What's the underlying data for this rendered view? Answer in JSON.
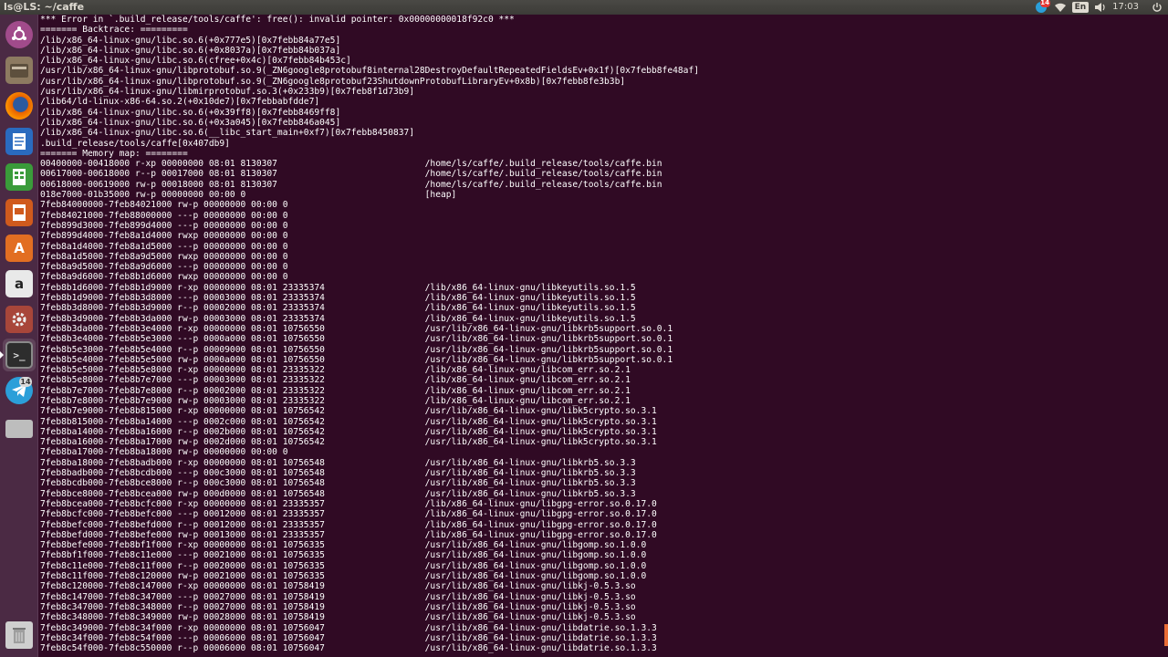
{
  "panel": {
    "window_title": "ls@LS: ~/caffe",
    "telegram_badge": "14",
    "language": "En",
    "time": "17:03"
  },
  "launcher": {
    "items": [
      {
        "name": "dash-icon",
        "glyph": ""
      },
      {
        "name": "files-icon",
        "glyph": ""
      },
      {
        "name": "firefox-icon",
        "glyph": ""
      },
      {
        "name": "writer-icon",
        "glyph": ""
      },
      {
        "name": "calc-icon",
        "glyph": ""
      },
      {
        "name": "impress-icon",
        "glyph": ""
      },
      {
        "name": "software-center-icon",
        "glyph": "A"
      },
      {
        "name": "amazon-icon",
        "glyph": "a"
      },
      {
        "name": "settings-icon",
        "glyph": ""
      },
      {
        "name": "terminal-icon",
        "glyph": ">_"
      },
      {
        "name": "telegram-icon",
        "glyph": "",
        "badge": "14"
      },
      {
        "name": "drive-icon",
        "glyph": ""
      },
      {
        "name": "trash-icon",
        "glyph": ""
      }
    ]
  },
  "terminal": {
    "lines": [
      "*** Error in `.build_release/tools/caffe': free(): invalid pointer: 0x00000000018f92c0 ***",
      "======= Backtrace: =========",
      "/lib/x86_64-linux-gnu/libc.so.6(+0x777e5)[0x7febb84a77e5]",
      "/lib/x86_64-linux-gnu/libc.so.6(+0x8037a)[0x7febb84b037a]",
      "/lib/x86_64-linux-gnu/libc.so.6(cfree+0x4c)[0x7febb84b453c]",
      "/usr/lib/x86_64-linux-gnu/libprotobuf.so.9(_ZN6google8protobuf8internal28DestroyDefaultRepeatedFieldsEv+0x1f)[0x7febb8fe48af]",
      "/usr/lib/x86_64-linux-gnu/libprotobuf.so.9(_ZN6google8protobuf23ShutdownProtobufLibraryEv+0x8b)[0x7febb8fe3b3b]",
      "/usr/lib/x86_64-linux-gnu/libmirprotobuf.so.3(+0x233b9)[0x7feb8f1d73b9]",
      "/lib64/ld-linux-x86-64.so.2(+0x10de7)[0x7febbabfdde7]",
      "/lib/x86_64-linux-gnu/libc.so.6(+0x39ff8)[0x7febb8469ff8]",
      "/lib/x86_64-linux-gnu/libc.so.6(+0x3a045)[0x7febb846a045]",
      "/lib/x86_64-linux-gnu/libc.so.6(__libc_start_main+0xf7)[0x7febb8450837]",
      ".build_release/tools/caffe[0x407db9]",
      "======= Memory map: ========",
      "00400000-00418000 r-xp 00000000 08:01 8130307                            /home/ls/caffe/.build_release/tools/caffe.bin",
      "00617000-00618000 r--p 00017000 08:01 8130307                            /home/ls/caffe/.build_release/tools/caffe.bin",
      "00618000-00619000 rw-p 00018000 08:01 8130307                            /home/ls/caffe/.build_release/tools/caffe.bin",
      "018e7000-01b35000 rw-p 00000000 00:00 0                                  [heap]",
      "7feb84000000-7feb84021000 rw-p 00000000 00:00 0",
      "7feb84021000-7feb88000000 ---p 00000000 00:00 0",
      "7feb899d3000-7feb899d4000 ---p 00000000 00:00 0",
      "7feb899d4000-7feb8a1d4000 rwxp 00000000 00:00 0",
      "7feb8a1d4000-7feb8a1d5000 ---p 00000000 00:00 0",
      "7feb8a1d5000-7feb8a9d5000 rwxp 00000000 00:00 0",
      "7feb8a9d5000-7feb8a9d6000 ---p 00000000 00:00 0",
      "7feb8a9d6000-7feb8b1d6000 rwxp 00000000 00:00 0",
      "7feb8b1d6000-7feb8b1d9000 r-xp 00000000 08:01 23335374                   /lib/x86_64-linux-gnu/libkeyutils.so.1.5",
      "7feb8b1d9000-7feb8b3d8000 ---p 00003000 08:01 23335374                   /lib/x86_64-linux-gnu/libkeyutils.so.1.5",
      "7feb8b3d8000-7feb8b3d9000 r--p 00002000 08:01 23335374                   /lib/x86_64-linux-gnu/libkeyutils.so.1.5",
      "7feb8b3d9000-7feb8b3da000 rw-p 00003000 08:01 23335374                   /lib/x86_64-linux-gnu/libkeyutils.so.1.5",
      "7feb8b3da000-7feb8b3e4000 r-xp 00000000 08:01 10756550                   /usr/lib/x86_64-linux-gnu/libkrb5support.so.0.1",
      "7feb8b3e4000-7feb8b5e3000 ---p 0000a000 08:01 10756550                   /usr/lib/x86_64-linux-gnu/libkrb5support.so.0.1",
      "7feb8b5e3000-7feb8b5e4000 r--p 00009000 08:01 10756550                   /usr/lib/x86_64-linux-gnu/libkrb5support.so.0.1",
      "7feb8b5e4000-7feb8b5e5000 rw-p 0000a000 08:01 10756550                   /usr/lib/x86_64-linux-gnu/libkrb5support.so.0.1",
      "7feb8b5e5000-7feb8b5e8000 r-xp 00000000 08:01 23335322                   /lib/x86_64-linux-gnu/libcom_err.so.2.1",
      "7feb8b5e8000-7feb8b7e7000 ---p 00003000 08:01 23335322                   /lib/x86_64-linux-gnu/libcom_err.so.2.1",
      "7feb8b7e7000-7feb8b7e8000 r--p 00002000 08:01 23335322                   /lib/x86_64-linux-gnu/libcom_err.so.2.1",
      "7feb8b7e8000-7feb8b7e9000 rw-p 00003000 08:01 23335322                   /lib/x86_64-linux-gnu/libcom_err.so.2.1",
      "7feb8b7e9000-7feb8b815000 r-xp 00000000 08:01 10756542                   /usr/lib/x86_64-linux-gnu/libk5crypto.so.3.1",
      "7feb8b815000-7feb8ba14000 ---p 0002c000 08:01 10756542                   /usr/lib/x86_64-linux-gnu/libk5crypto.so.3.1",
      "7feb8ba14000-7feb8ba16000 r--p 0002b000 08:01 10756542                   /usr/lib/x86_64-linux-gnu/libk5crypto.so.3.1",
      "7feb8ba16000-7feb8ba17000 rw-p 0002d000 08:01 10756542                   /usr/lib/x86_64-linux-gnu/libk5crypto.so.3.1",
      "7feb8ba17000-7feb8ba18000 rw-p 00000000 00:00 0",
      "7feb8ba18000-7feb8badb000 r-xp 00000000 08:01 10756548                   /usr/lib/x86_64-linux-gnu/libkrb5.so.3.3",
      "7feb8badb000-7feb8bcdb000 ---p 000c3000 08:01 10756548                   /usr/lib/x86_64-linux-gnu/libkrb5.so.3.3",
      "7feb8bcdb000-7feb8bce8000 r--p 000c3000 08:01 10756548                   /usr/lib/x86_64-linux-gnu/libkrb5.so.3.3",
      "7feb8bce8000-7feb8bcea000 rw-p 000d0000 08:01 10756548                   /usr/lib/x86_64-linux-gnu/libkrb5.so.3.3",
      "7feb8bcea000-7feb8bcfc000 r-xp 00000000 08:01 23335357                   /lib/x86_64-linux-gnu/libgpg-error.so.0.17.0",
      "7feb8bcfc000-7feb8befc000 ---p 00012000 08:01 23335357                   /lib/x86_64-linux-gnu/libgpg-error.so.0.17.0",
      "7feb8befc000-7feb8befd000 r--p 00012000 08:01 23335357                   /lib/x86_64-linux-gnu/libgpg-error.so.0.17.0",
      "7feb8befd000-7feb8befe000 rw-p 00013000 08:01 23335357                   /lib/x86_64-linux-gnu/libgpg-error.so.0.17.0",
      "7feb8befe000-7feb8bf1f000 r-xp 00000000 08:01 10756335                   /usr/lib/x86_64-linux-gnu/libgomp.so.1.0.0",
      "7feb8bf1f000-7feb8c11e000 ---p 00021000 08:01 10756335                   /usr/lib/x86_64-linux-gnu/libgomp.so.1.0.0",
      "7feb8c11e000-7feb8c11f000 r--p 00020000 08:01 10756335                   /usr/lib/x86_64-linux-gnu/libgomp.so.1.0.0",
      "7feb8c11f000-7feb8c120000 rw-p 00021000 08:01 10756335                   /usr/lib/x86_64-linux-gnu/libgomp.so.1.0.0",
      "7feb8c120000-7feb8c147000 r-xp 00000000 08:01 10758419                   /usr/lib/x86_64-linux-gnu/libkj-0.5.3.so",
      "7feb8c147000-7feb8c347000 ---p 00027000 08:01 10758419                   /usr/lib/x86_64-linux-gnu/libkj-0.5.3.so",
      "7feb8c347000-7feb8c348000 r--p 00027000 08:01 10758419                   /usr/lib/x86_64-linux-gnu/libkj-0.5.3.so",
      "7feb8c348000-7feb8c349000 rw-p 00028000 08:01 10758419                   /usr/lib/x86_64-linux-gnu/libkj-0.5.3.so",
      "7feb8c349000-7feb8c34f000 r-xp 00000000 08:01 10756047                   /usr/lib/x86_64-linux-gnu/libdatrie.so.1.3.3",
      "7feb8c34f000-7feb8c54f000 ---p 00006000 08:01 10756047                   /usr/lib/x86_64-linux-gnu/libdatrie.so.1.3.3",
      "7feb8c54f000-7feb8c550000 r--p 00006000 08:01 10756047                   /usr/lib/x86_64-linux-gnu/libdatrie.so.1.3.3"
    ]
  }
}
